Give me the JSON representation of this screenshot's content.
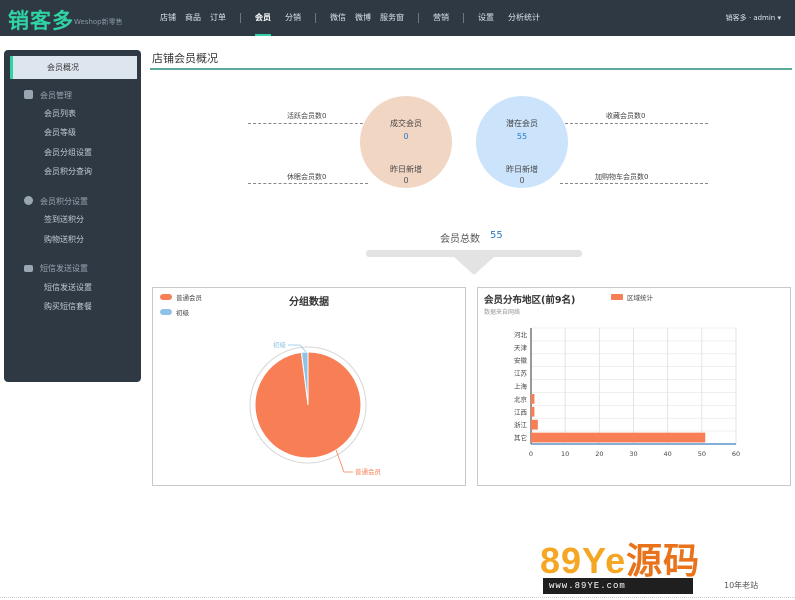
{
  "header": {
    "logo": "销客多",
    "logo_sub": "Weshop新零售",
    "nav": [
      "店铺",
      "商品",
      "订单",
      "会员",
      "分销",
      "微信",
      "微博",
      "服务窗",
      "营销",
      "设置",
      "分析统计"
    ],
    "active_nav": "会员",
    "user": "销客多 · admin ▾"
  },
  "sidebar": {
    "active": "会员概况",
    "groups": [
      {
        "title": "会员管理",
        "icon": "user-icon",
        "items": [
          "会员列表",
          "会员等级",
          "会员分组设置",
          "会员积分查询"
        ]
      },
      {
        "title": "会员积分设置",
        "icon": "coin-icon",
        "items": [
          "签到送积分",
          "购物送积分"
        ]
      },
      {
        "title": "短信发送设置",
        "icon": "message-icon",
        "items": [
          "短信发送设置",
          "购买短信套餐"
        ]
      }
    ]
  },
  "main": {
    "title": "店铺会员概况",
    "stats": {
      "active_label": "活跃会员数0",
      "sleep_label": "休眠会员数0",
      "fav_label": "收藏会员数0",
      "cart_label": "加购物车会员数0"
    },
    "sold": {
      "title": "成交会员",
      "value": "0",
      "sub_title": "昨日新增",
      "sub_value": "0"
    },
    "latent": {
      "title": "潜在会员",
      "value": "55",
      "sub_title": "昨日新增",
      "sub_value": "0"
    },
    "total_label": "会员总数",
    "total_value": "55"
  },
  "chart_data": [
    {
      "type": "pie",
      "title": "分组数据",
      "legend": [
        "普通会员",
        "初级"
      ],
      "slices": [
        {
          "name": "普通会员",
          "value": 98,
          "color": "#f87e56"
        },
        {
          "name": "初级",
          "value": 2,
          "color": "#8fc3e6"
        }
      ],
      "legend_position": "top-left"
    },
    {
      "type": "bar",
      "orientation": "horizontal",
      "title": "会员分布地区(前9名)",
      "subtitle": "数据来自网络",
      "legend": [
        "区域统计"
      ],
      "categories": [
        "河北",
        "天津",
        "安徽",
        "江苏",
        "上海",
        "北京",
        "江西",
        "浙江",
        "其它"
      ],
      "values": [
        0,
        0,
        0,
        0,
        0,
        1,
        1,
        2,
        51
      ],
      "xlim": [
        0,
        60
      ],
      "xticks": [
        "0",
        "10",
        "20",
        "30",
        "40",
        "50",
        "60"
      ],
      "grid": true,
      "bar_color": "#f87e56"
    }
  ],
  "watermark": {
    "logo_text": "89Ye",
    "logo_cn": "源码",
    "sub": "www.89YE.com",
    "tag": "10年老站"
  }
}
